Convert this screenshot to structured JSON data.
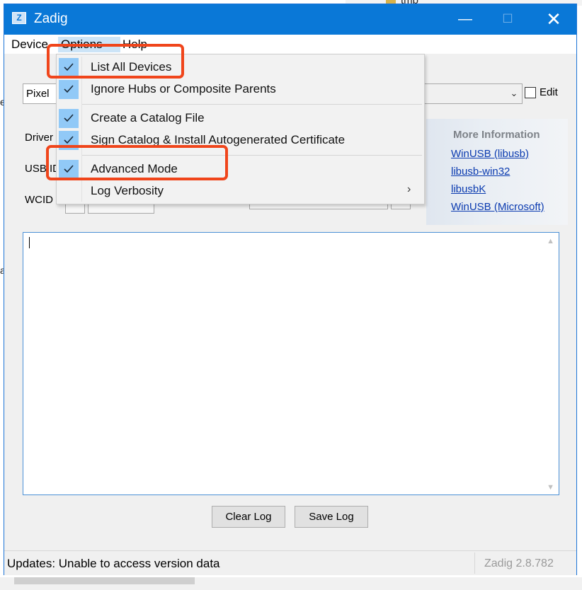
{
  "background": {
    "folder_text": "tmp",
    "left_fragments": [
      "e",
      "a"
    ]
  },
  "window": {
    "title": "Zadig",
    "app_icon_glyph": "Z",
    "minimize": "—",
    "maximize": "☐",
    "close": "✕"
  },
  "menubar": {
    "items": [
      {
        "label": "Device"
      },
      {
        "label": "Options"
      },
      {
        "label": "Help"
      }
    ]
  },
  "options_menu": {
    "items": [
      {
        "label": "List All Devices",
        "checked": true
      },
      {
        "label": "Ignore Hubs or Composite Parents",
        "checked": true
      },
      {
        "label": "Create a Catalog File",
        "checked": true
      },
      {
        "label": "Sign Catalog & Install Autogenerated Certificate",
        "checked": true
      },
      {
        "label": "Advanced Mode",
        "checked": true
      },
      {
        "label": "Log Verbosity",
        "checked": false,
        "submenu_arrow": "›"
      }
    ]
  },
  "device_select": {
    "value": "Pixel"
  },
  "edit": {
    "label": "Edit",
    "checked": false
  },
  "labels": {
    "driver": "Driver",
    "usb_id": "USB ID",
    "wcid": "WCID"
  },
  "more_info": {
    "title": "More Information",
    "links": [
      "WinUSB (libusb)",
      "libusb-win32",
      "libusbK",
      "WinUSB (Microsoft)"
    ]
  },
  "log": {
    "content": ""
  },
  "buttons": {
    "clear_log": "Clear Log",
    "save_log": "Save Log"
  },
  "status": {
    "text": "Updates: Unable to access version data",
    "version": "Zadig 2.8.782"
  },
  "colors": {
    "titlebar": "#0a78d7",
    "annotation": "#f0451b",
    "check_highlight": "#91c9f7",
    "link": "#0b3bb0"
  }
}
